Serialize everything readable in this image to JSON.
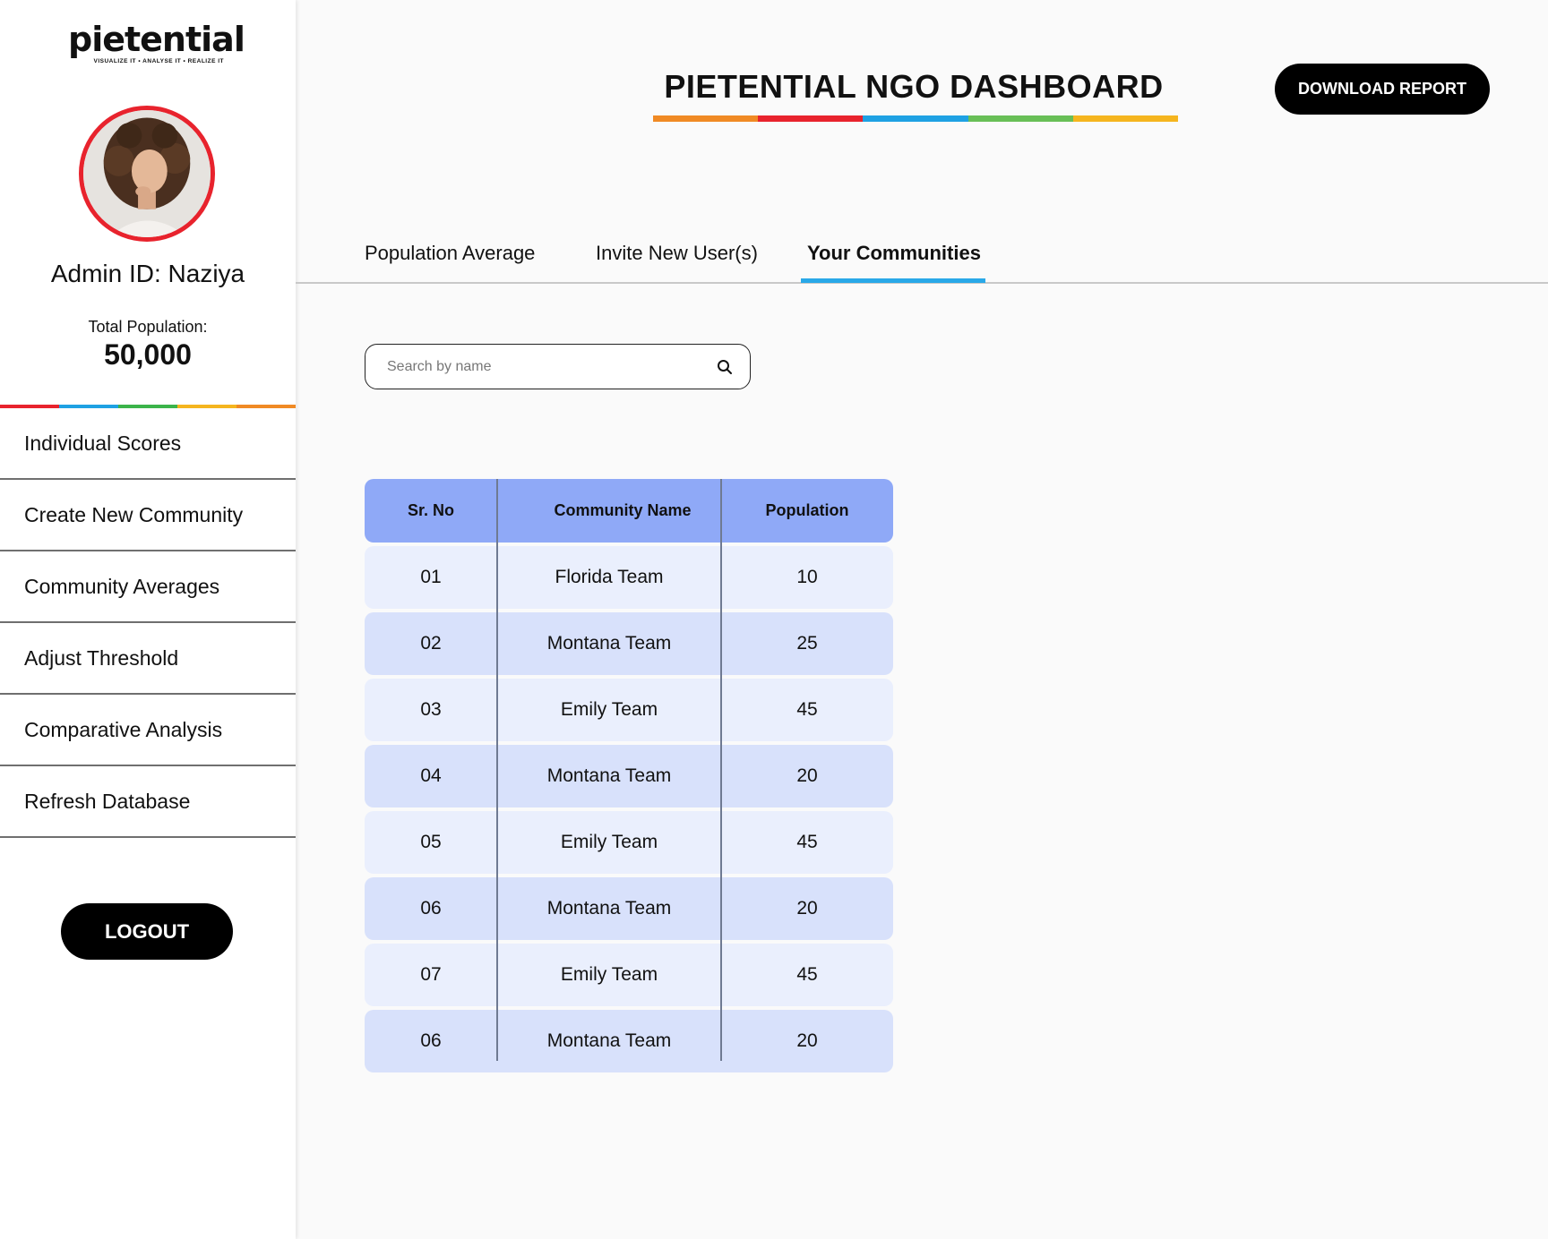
{
  "brand": {
    "logo_text": "pietential",
    "tagline": "VISUALIZE IT • ANALYSE IT • REALIZE IT"
  },
  "profile": {
    "admin_id": "Admin ID: Naziya",
    "population_label": "Total Population:",
    "population_value": "50,000"
  },
  "sidebar": {
    "items": [
      {
        "label": "Individual Scores"
      },
      {
        "label": "Create New Community"
      },
      {
        "label": "Community Averages"
      },
      {
        "label": "Adjust Threshold"
      },
      {
        "label": "Comparative Analysis"
      },
      {
        "label": "Refresh Database"
      }
    ],
    "logout_label": "LOGOUT"
  },
  "header": {
    "title": "PIETENTIAL NGO DASHBOARD",
    "download_label": "DOWNLOAD REPORT"
  },
  "tabs": [
    {
      "label": "Population Average",
      "active": false
    },
    {
      "label": "Invite New User(s)",
      "active": false
    },
    {
      "label": "Your Communities",
      "active": true
    }
  ],
  "search": {
    "placeholder": "Search by name",
    "value": ""
  },
  "table": {
    "headers": [
      "Sr. No",
      "Community Name",
      "Population"
    ],
    "rows": [
      [
        "01",
        "Florida Team",
        "10"
      ],
      [
        "02",
        "Montana Team",
        "25"
      ],
      [
        "03",
        "Emily Team",
        "45"
      ],
      [
        "04",
        "Montana Team",
        "20"
      ],
      [
        "05",
        "Emily Team",
        "45"
      ],
      [
        "06",
        "Montana Team",
        "20"
      ],
      [
        "07",
        "Emily Team",
        "45"
      ],
      [
        "06",
        "Montana Team",
        "20"
      ]
    ]
  },
  "colors": {
    "rainbow": [
      "#f08a24",
      "#e8232d",
      "#1ea1e3",
      "#68bf57",
      "#f5b51e"
    ],
    "sidebar_rainbow": [
      "#e8232d",
      "#1ea1e3",
      "#3bb44a",
      "#f5b51e",
      "#f08a24"
    ],
    "table_header": "#8fa9f7",
    "row_light": "#eaeffd",
    "row_dark": "#d8e1fb",
    "tab_active_underline": "#29a8e8",
    "avatar_border": "#e8232d"
  },
  "icons": {
    "search": "search-icon"
  }
}
